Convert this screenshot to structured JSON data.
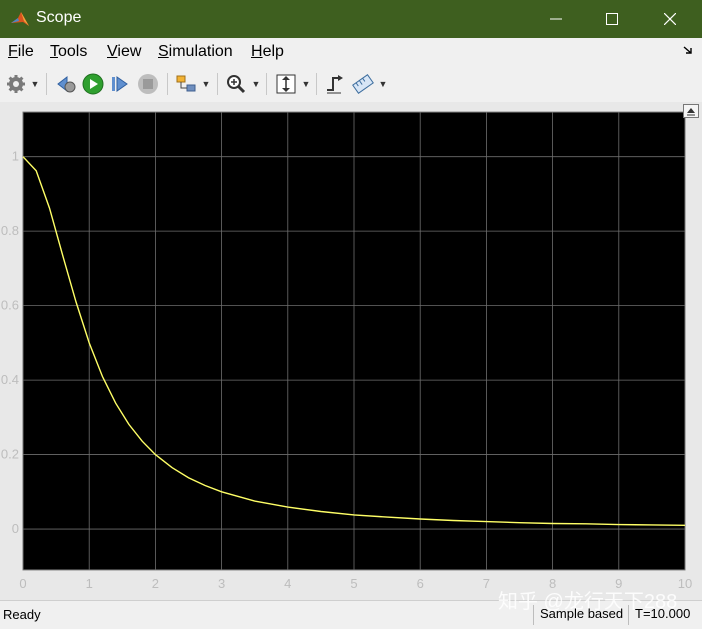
{
  "window": {
    "title": "Scope"
  },
  "menu": [
    {
      "label": "File",
      "key": "F",
      "rest": "ile"
    },
    {
      "label": "Tools",
      "key": "T",
      "rest": "ools"
    },
    {
      "label": "View",
      "key": "V",
      "rest": "iew"
    },
    {
      "label": "Simulation",
      "key": "S",
      "rest": "imulation"
    },
    {
      "label": "Help",
      "key": "H",
      "rest": "elp"
    }
  ],
  "toolbar": {
    "icons": [
      "configuration-gear-icon",
      "step-back-icon",
      "run-icon",
      "step-forward-icon",
      "stop-icon",
      "highlight-block-icon",
      "zoom-in-icon",
      "autoscale-icon",
      "triggers-icon",
      "measurements-icon"
    ]
  },
  "status": {
    "ready": "Ready",
    "sample_mode": "Sample based",
    "time": "T=10.000"
  },
  "watermark": "知乎 @龙行天下288",
  "colors": {
    "titlebar": "#3e5f1f",
    "plot_background": "#000000",
    "trace": "#ffff66",
    "grid": "#6e6e6e",
    "tick_label": "#bdbdbd"
  },
  "chart_data": {
    "type": "line",
    "title": "",
    "xlabel": "",
    "ylabel": "",
    "xlim": [
      0,
      10
    ],
    "ylim": [
      -0.11,
      1.12
    ],
    "xticks": [
      0,
      1,
      2,
      3,
      4,
      5,
      6,
      7,
      8,
      9,
      10
    ],
    "yticks": [
      0,
      0.2,
      0.4,
      0.6,
      0.8,
      1
    ],
    "grid": true,
    "series": [
      {
        "x": [
          0,
          0.2,
          0.4,
          0.6,
          0.8,
          1.0,
          1.2,
          1.4,
          1.6,
          1.8,
          2.0,
          2.25,
          2.5,
          2.75,
          3.0,
          3.5,
          4.0,
          4.5,
          5.0,
          5.5,
          6.0,
          6.5,
          7.0,
          7.5,
          8.0,
          8.5,
          9.0,
          9.5,
          10.0
        ],
        "y": [
          1.0,
          0.962,
          0.862,
          0.735,
          0.61,
          0.5,
          0.41,
          0.338,
          0.281,
          0.236,
          0.2,
          0.165,
          0.138,
          0.117,
          0.1,
          0.075,
          0.059,
          0.047,
          0.038,
          0.032,
          0.027,
          0.023,
          0.02,
          0.017,
          0.015,
          0.014,
          0.012,
          0.011,
          0.01
        ]
      }
    ]
  }
}
